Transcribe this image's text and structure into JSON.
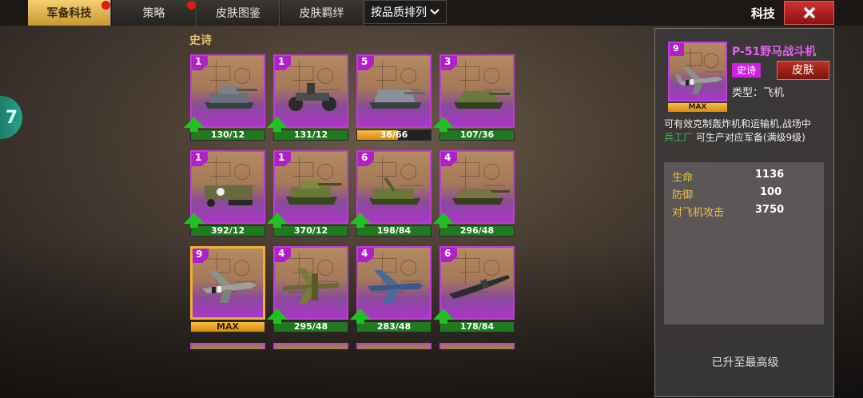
{
  "tabs": [
    {
      "label": "军备科技",
      "active": true,
      "dot": true
    },
    {
      "label": "策略",
      "active": false,
      "dot": true
    },
    {
      "label": "皮肤图鉴",
      "active": false,
      "dot": false
    },
    {
      "label": "皮肤羁绊",
      "active": false,
      "dot": false
    }
  ],
  "sort_label": "按品质排列",
  "header_title": "科技",
  "side_tab_glyph": "7",
  "section_label": "史诗",
  "units": [
    {
      "level": "1",
      "progress": "130/12",
      "bar": "upgrade",
      "icon": "light-tank-icon"
    },
    {
      "level": "1",
      "progress": "131/12",
      "bar": "upgrade",
      "icon": "motorcycle-icon"
    },
    {
      "level": "5",
      "progress": "36/66",
      "bar": "partial",
      "fraction": 0.55,
      "icon": "assault-gun-icon"
    },
    {
      "level": "3",
      "progress": "107/36",
      "bar": "upgrade",
      "icon": "tank-destroyer-icon"
    },
    {
      "level": "1",
      "progress": "392/12",
      "bar": "upgrade",
      "icon": "halftrack-icon"
    },
    {
      "level": "1",
      "progress": "370/12",
      "bar": "upgrade",
      "icon": "medium-tank-icon"
    },
    {
      "level": "6",
      "progress": "198/84",
      "bar": "upgrade",
      "icon": "self-propelled-gun-icon"
    },
    {
      "level": "4",
      "progress": "296/48",
      "bar": "upgrade",
      "icon": "jagdpanzer-icon"
    },
    {
      "level": "9",
      "progress": "MAX",
      "bar": "max",
      "selected": true,
      "icon": "fighter-plane-icon"
    },
    {
      "level": "4",
      "progress": "295/48",
      "bar": "upgrade",
      "icon": "bomber-plane-icon"
    },
    {
      "level": "4",
      "progress": "283/48",
      "bar": "upgrade",
      "icon": "navy-fighter-icon"
    },
    {
      "level": "6",
      "progress": "178/84",
      "bar": "upgrade",
      "icon": "submarine-icon"
    }
  ],
  "detail": {
    "level": "9",
    "max_label": "MAX",
    "name": "P-51野马战斗机",
    "rarity": "史诗",
    "skin_button": "皮肤",
    "type_line": "类型：飞机",
    "desc_part1": "可有效克制轰炸机和运输机,战场中",
    "desc_highlight": "兵工厂",
    "desc_part2": "可生产对应军备(满级9级)",
    "stats": [
      {
        "label": "生命",
        "value": "1136"
      },
      {
        "label": "防御",
        "value": "100"
      },
      {
        "label": "对飞机攻击",
        "value": "3750"
      }
    ],
    "status": "已升至最高级"
  },
  "colors": {
    "epic": "#c23ad8",
    "gold": "#f0b030",
    "upgrade_green": "#22c022"
  }
}
